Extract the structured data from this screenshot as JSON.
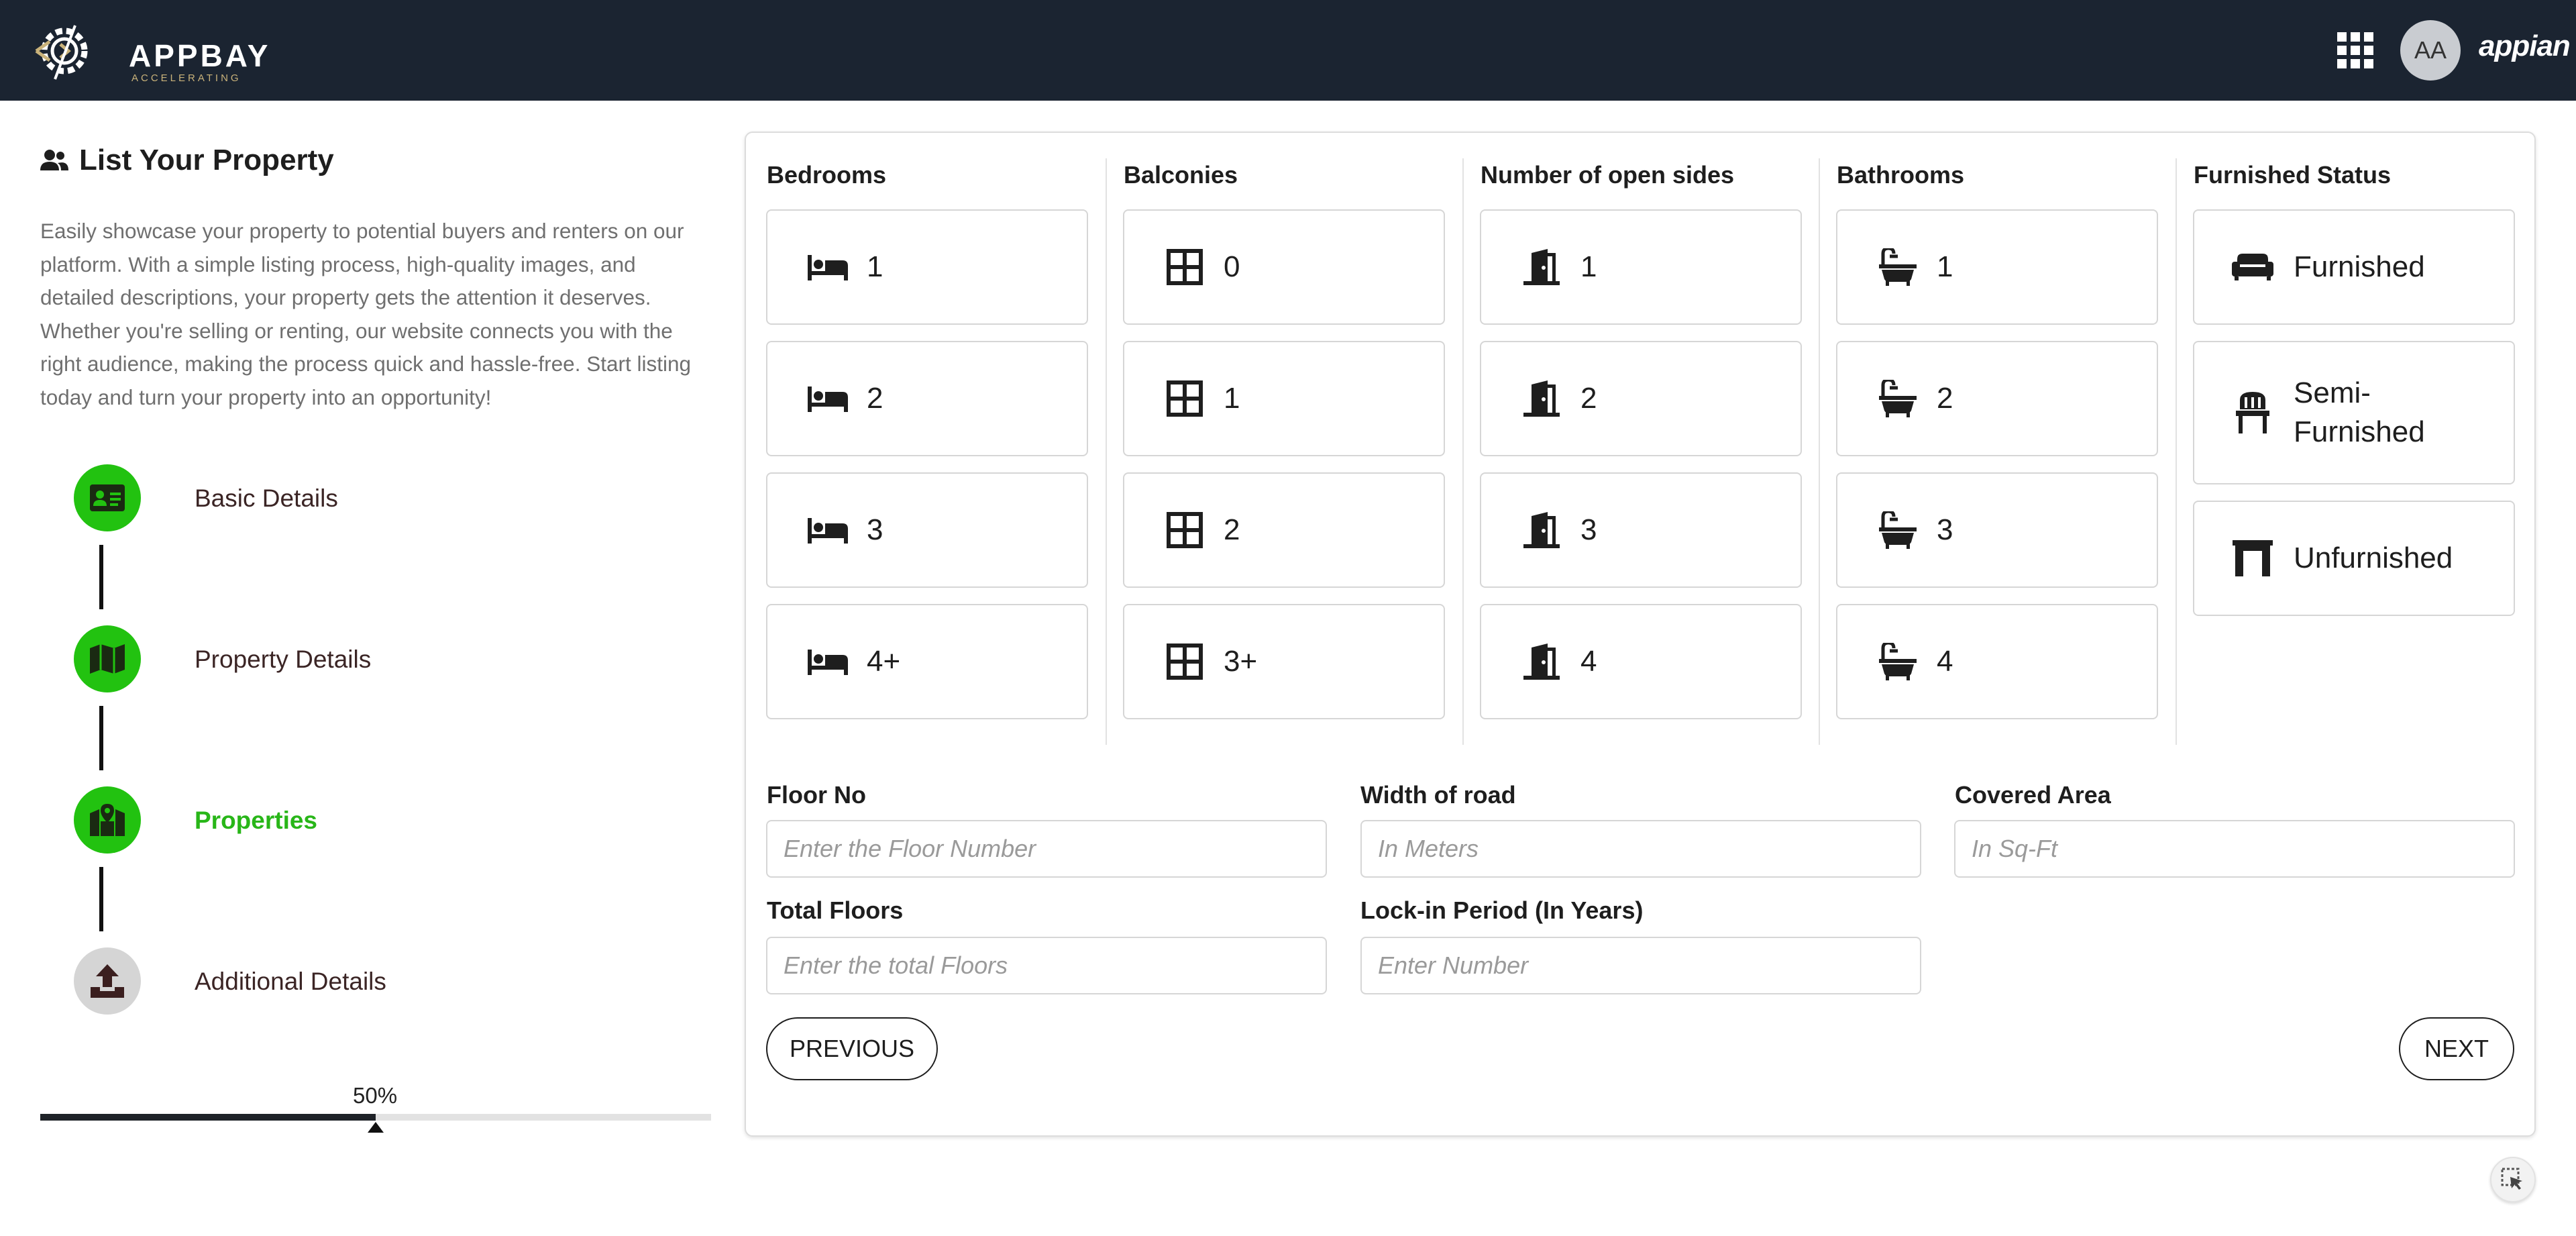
{
  "header": {
    "logo_text": "APPBAY",
    "logo_tagline": "ACCELERATING",
    "avatar_initials": "AA",
    "brand": "appian"
  },
  "sidebar": {
    "title": "List Your Property",
    "description": "Easily showcase your property to potential buyers and renters on our platform. With a simple listing process, high-quality images, and detailed descriptions, your property gets the attention it deserves. Whether you're selling or renting, our website connects you with the right audience, making the process quick and hassle-free. Start listing today and turn your property into an opportunity!",
    "steps": [
      {
        "label": "Basic Details",
        "status": "done",
        "icon": "id-card-icon"
      },
      {
        "label": "Property Details",
        "status": "done",
        "icon": "map-icon"
      },
      {
        "label": "Properties",
        "status": "active",
        "icon": "map-pin-icon"
      },
      {
        "label": "Additional Details",
        "status": "todo",
        "icon": "upload-icon"
      }
    ],
    "progress_label": "50%",
    "progress_value": 0.5
  },
  "form": {
    "bedrooms": {
      "title": "Bedrooms",
      "icon": "bed-icon",
      "options": [
        "1",
        "2",
        "3",
        "4+"
      ]
    },
    "balconies": {
      "title": "Balconies",
      "icon": "window-icon",
      "options": [
        "0",
        "1",
        "2",
        "3+"
      ]
    },
    "open_sides": {
      "title": "Number of open sides",
      "icon": "door-open-icon",
      "options": [
        "1",
        "2",
        "3",
        "4"
      ]
    },
    "bathrooms": {
      "title": "Bathrooms",
      "icon": "bathtub-icon",
      "options": [
        "1",
        "2",
        "3",
        "4"
      ]
    },
    "furnished": {
      "title": "Furnished Status",
      "options": [
        {
          "label": "Furnished",
          "icon": "sofa-icon"
        },
        {
          "label": "Semi-\nFurnished",
          "icon": "chair-icon"
        },
        {
          "label": "Unfurnished",
          "icon": "empty-room-icon"
        }
      ]
    },
    "floor_no": {
      "label": "Floor No",
      "placeholder": "Enter the Floor Number"
    },
    "width_of_road": {
      "label": "Width of road",
      "placeholder": "In Meters"
    },
    "covered_area": {
      "label": "Covered Area",
      "placeholder": "In Sq-Ft"
    },
    "total_floors": {
      "label": "Total Floors",
      "placeholder": "Enter the total Floors"
    },
    "lock_in": {
      "label": "Lock-in Period (In Years)",
      "placeholder": "Enter Number"
    },
    "previous_label": "PREVIOUS",
    "next_label": "NEXT"
  },
  "colors": {
    "topbar": "#1b2431",
    "step_done": "#22c210",
    "step_active_text": "#28b618",
    "step_todo": "#d5d5d5"
  }
}
